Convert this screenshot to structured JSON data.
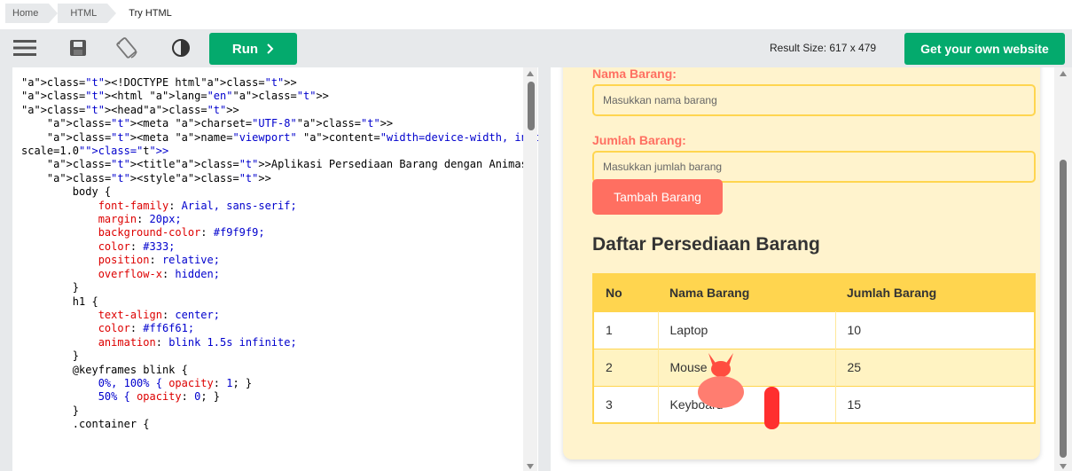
{
  "breadcrumb": [
    "Home",
    "HTML",
    "Try HTML"
  ],
  "toolbar": {
    "menu_icon": "hamburger-icon",
    "save_icon": "floppy-disk-icon",
    "rotate_icon": "rotate-layout-icon",
    "theme_icon": "contrast-icon",
    "run_label": "Run",
    "result_size": "Result Size: 617 x 479",
    "own_website_label": "Get your own website"
  },
  "colors": {
    "accent_green": "#04aa6d",
    "coral": "#ff6f61",
    "yellow": "#ffd54f",
    "card_bg": "#fff3cd"
  },
  "code_lines": [
    "<!DOCTYPE html>",
    "<html lang=\"en\">",
    "<head>",
    "    <meta charset=\"UTF-8\">",
    "    <meta name=\"viewport\" content=\"width=device-width, initial-",
    "scale=1.0\">",
    "    <title>Aplikasi Persediaan Barang dengan Animasi Kucing</title>",
    "    <style>",
    "        body {",
    "            font-family: Arial, sans-serif;",
    "            margin: 20px;",
    "            background-color: #f9f9f9;",
    "            color: #333;",
    "            position: relative;",
    "            overflow-x: hidden;",
    "        }",
    "        h1 {",
    "            text-align: center;",
    "            color: #ff6f61;",
    "            animation: blink 1.5s infinite;",
    "        }",
    "        @keyframes blink {",
    "            0%, 100% { opacity: 1; }",
    "            50% { opacity: 0; }",
    "        }",
    "        .container {"
  ],
  "result": {
    "name_label": "Nama Barang:",
    "name_placeholder": "Masukkan nama barang",
    "qty_label": "Jumlah Barang:",
    "qty_placeholder": "Masukkan jumlah barang",
    "add_button": "Tambah Barang",
    "list_title": "Daftar Persediaan Barang",
    "table": {
      "headers": [
        "No",
        "Nama Barang",
        "Jumlah Barang"
      ],
      "rows": [
        [
          "1",
          "Laptop",
          "10"
        ],
        [
          "2",
          "Mouse",
          "25"
        ],
        [
          "3",
          "Keyboard",
          "15"
        ]
      ]
    }
  }
}
